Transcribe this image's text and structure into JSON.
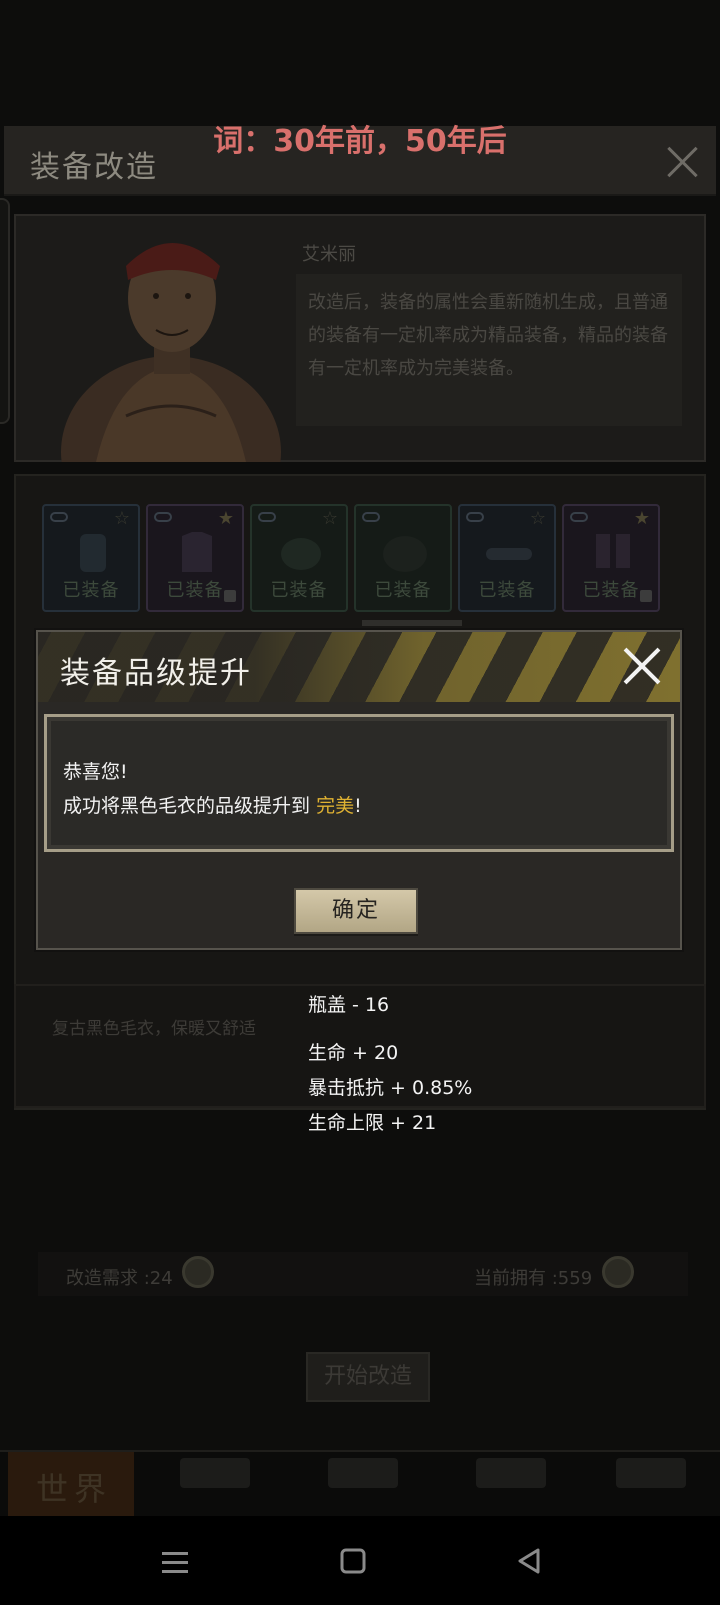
{
  "caption": "词：30年前，50年后",
  "panel": {
    "title": "装备改造"
  },
  "npc": {
    "name": "艾米丽",
    "description": "改造后，装备的属性会重新随机生成，且普通的装备有一定机率成为精品装备，精品的装备有一定机率成为完美装备。"
  },
  "equipment_slots": [
    {
      "label": "已装备",
      "star": "☆",
      "locked": false
    },
    {
      "label": "已装备",
      "star": "★",
      "locked": true
    },
    {
      "label": "已装备",
      "star": "☆",
      "locked": false
    },
    {
      "label": "已装备",
      "star": "",
      "locked": false
    },
    {
      "label": "已装备",
      "star": "☆",
      "locked": false
    },
    {
      "label": "已装备",
      "star": "★",
      "locked": true
    }
  ],
  "item": {
    "description": "复古黑色毛衣，保暖又舒适",
    "stats": [
      "瓶盖 - 16",
      "生命 + 20",
      "暴击抵抗 + 0.85%",
      "生命上限 + 21"
    ]
  },
  "cost": {
    "required": "改造需求 :24",
    "owned": "当前拥有 :559"
  },
  "start_button": "开始改造",
  "nav": {
    "world": "世界"
  },
  "dialog": {
    "title": "装备品级提升",
    "line1": "恭喜您!",
    "line2_prefix": "成功将黑色毛衣的品级提升到",
    "line2_highlight": "完美",
    "line2_suffix": "!",
    "confirm": "确定"
  },
  "colors": {
    "caption": "#d9706c",
    "highlight": "#e0b232",
    "hazard_stripe": "#c7ad3a"
  }
}
